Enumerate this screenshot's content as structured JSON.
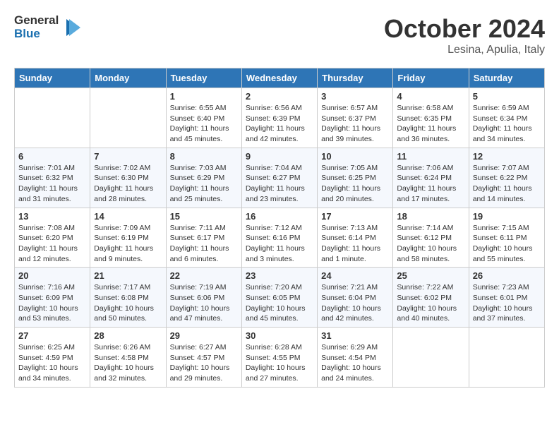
{
  "logo": {
    "text_general": "General",
    "text_blue": "Blue"
  },
  "header": {
    "month": "October 2024",
    "location": "Lesina, Apulia, Italy"
  },
  "weekdays": [
    "Sunday",
    "Monday",
    "Tuesday",
    "Wednesday",
    "Thursday",
    "Friday",
    "Saturday"
  ],
  "weeks": [
    [
      {
        "day": "",
        "info": ""
      },
      {
        "day": "",
        "info": ""
      },
      {
        "day": "1",
        "info": "Sunrise: 6:55 AM\nSunset: 6:40 PM\nDaylight: 11 hours and 45 minutes."
      },
      {
        "day": "2",
        "info": "Sunrise: 6:56 AM\nSunset: 6:39 PM\nDaylight: 11 hours and 42 minutes."
      },
      {
        "day": "3",
        "info": "Sunrise: 6:57 AM\nSunset: 6:37 PM\nDaylight: 11 hours and 39 minutes."
      },
      {
        "day": "4",
        "info": "Sunrise: 6:58 AM\nSunset: 6:35 PM\nDaylight: 11 hours and 36 minutes."
      },
      {
        "day": "5",
        "info": "Sunrise: 6:59 AM\nSunset: 6:34 PM\nDaylight: 11 hours and 34 minutes."
      }
    ],
    [
      {
        "day": "6",
        "info": "Sunrise: 7:01 AM\nSunset: 6:32 PM\nDaylight: 11 hours and 31 minutes."
      },
      {
        "day": "7",
        "info": "Sunrise: 7:02 AM\nSunset: 6:30 PM\nDaylight: 11 hours and 28 minutes."
      },
      {
        "day": "8",
        "info": "Sunrise: 7:03 AM\nSunset: 6:29 PM\nDaylight: 11 hours and 25 minutes."
      },
      {
        "day": "9",
        "info": "Sunrise: 7:04 AM\nSunset: 6:27 PM\nDaylight: 11 hours and 23 minutes."
      },
      {
        "day": "10",
        "info": "Sunrise: 7:05 AM\nSunset: 6:25 PM\nDaylight: 11 hours and 20 minutes."
      },
      {
        "day": "11",
        "info": "Sunrise: 7:06 AM\nSunset: 6:24 PM\nDaylight: 11 hours and 17 minutes."
      },
      {
        "day": "12",
        "info": "Sunrise: 7:07 AM\nSunset: 6:22 PM\nDaylight: 11 hours and 14 minutes."
      }
    ],
    [
      {
        "day": "13",
        "info": "Sunrise: 7:08 AM\nSunset: 6:20 PM\nDaylight: 11 hours and 12 minutes."
      },
      {
        "day": "14",
        "info": "Sunrise: 7:09 AM\nSunset: 6:19 PM\nDaylight: 11 hours and 9 minutes."
      },
      {
        "day": "15",
        "info": "Sunrise: 7:11 AM\nSunset: 6:17 PM\nDaylight: 11 hours and 6 minutes."
      },
      {
        "day": "16",
        "info": "Sunrise: 7:12 AM\nSunset: 6:16 PM\nDaylight: 11 hours and 3 minutes."
      },
      {
        "day": "17",
        "info": "Sunrise: 7:13 AM\nSunset: 6:14 PM\nDaylight: 11 hours and 1 minute."
      },
      {
        "day": "18",
        "info": "Sunrise: 7:14 AM\nSunset: 6:12 PM\nDaylight: 10 hours and 58 minutes."
      },
      {
        "day": "19",
        "info": "Sunrise: 7:15 AM\nSunset: 6:11 PM\nDaylight: 10 hours and 55 minutes."
      }
    ],
    [
      {
        "day": "20",
        "info": "Sunrise: 7:16 AM\nSunset: 6:09 PM\nDaylight: 10 hours and 53 minutes."
      },
      {
        "day": "21",
        "info": "Sunrise: 7:17 AM\nSunset: 6:08 PM\nDaylight: 10 hours and 50 minutes."
      },
      {
        "day": "22",
        "info": "Sunrise: 7:19 AM\nSunset: 6:06 PM\nDaylight: 10 hours and 47 minutes."
      },
      {
        "day": "23",
        "info": "Sunrise: 7:20 AM\nSunset: 6:05 PM\nDaylight: 10 hours and 45 minutes."
      },
      {
        "day": "24",
        "info": "Sunrise: 7:21 AM\nSunset: 6:04 PM\nDaylight: 10 hours and 42 minutes."
      },
      {
        "day": "25",
        "info": "Sunrise: 7:22 AM\nSunset: 6:02 PM\nDaylight: 10 hours and 40 minutes."
      },
      {
        "day": "26",
        "info": "Sunrise: 7:23 AM\nSunset: 6:01 PM\nDaylight: 10 hours and 37 minutes."
      }
    ],
    [
      {
        "day": "27",
        "info": "Sunrise: 6:25 AM\nSunset: 4:59 PM\nDaylight: 10 hours and 34 minutes."
      },
      {
        "day": "28",
        "info": "Sunrise: 6:26 AM\nSunset: 4:58 PM\nDaylight: 10 hours and 32 minutes."
      },
      {
        "day": "29",
        "info": "Sunrise: 6:27 AM\nSunset: 4:57 PM\nDaylight: 10 hours and 29 minutes."
      },
      {
        "day": "30",
        "info": "Sunrise: 6:28 AM\nSunset: 4:55 PM\nDaylight: 10 hours and 27 minutes."
      },
      {
        "day": "31",
        "info": "Sunrise: 6:29 AM\nSunset: 4:54 PM\nDaylight: 10 hours and 24 minutes."
      },
      {
        "day": "",
        "info": ""
      },
      {
        "day": "",
        "info": ""
      }
    ]
  ]
}
